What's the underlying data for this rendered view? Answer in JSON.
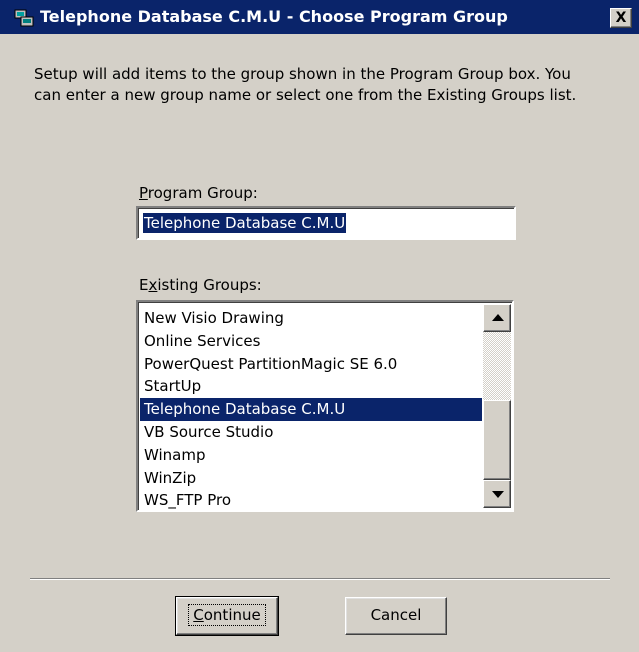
{
  "window": {
    "title": "Telephone Database C.M.U - Choose Program Group",
    "close_label": "X"
  },
  "description": "Setup will add items to the group shown in the Program Group box. You can enter a new group name or select one from the Existing Groups list.",
  "program_group": {
    "label_mnemonic": "P",
    "label_rest": "rogram Group:",
    "value": "Telephone Database C.M.U"
  },
  "existing_groups": {
    "label_pre": "E",
    "label_mnemonic": "x",
    "label_rest": "isting Groups:",
    "items": [
      "New Visio Drawing",
      "Online Services",
      "PowerQuest PartitionMagic SE 6.0",
      "StartUp",
      "Telephone Database C.M.U",
      "VB Source Studio",
      "Winamp",
      "WinZip",
      "WS_FTP Pro"
    ],
    "selected_index": 4
  },
  "buttons": {
    "continue_mnemonic": "C",
    "continue_rest": "ontinue",
    "cancel": "Cancel"
  },
  "colors": {
    "titlebar": "#0a246a",
    "face": "#d4d0c8",
    "selection": "#0a246a"
  },
  "icons": {
    "app": "setup-computer-icon",
    "close": "close-icon",
    "scroll_up": "scroll-up-arrow-icon",
    "scroll_down": "scroll-down-arrow-icon"
  }
}
